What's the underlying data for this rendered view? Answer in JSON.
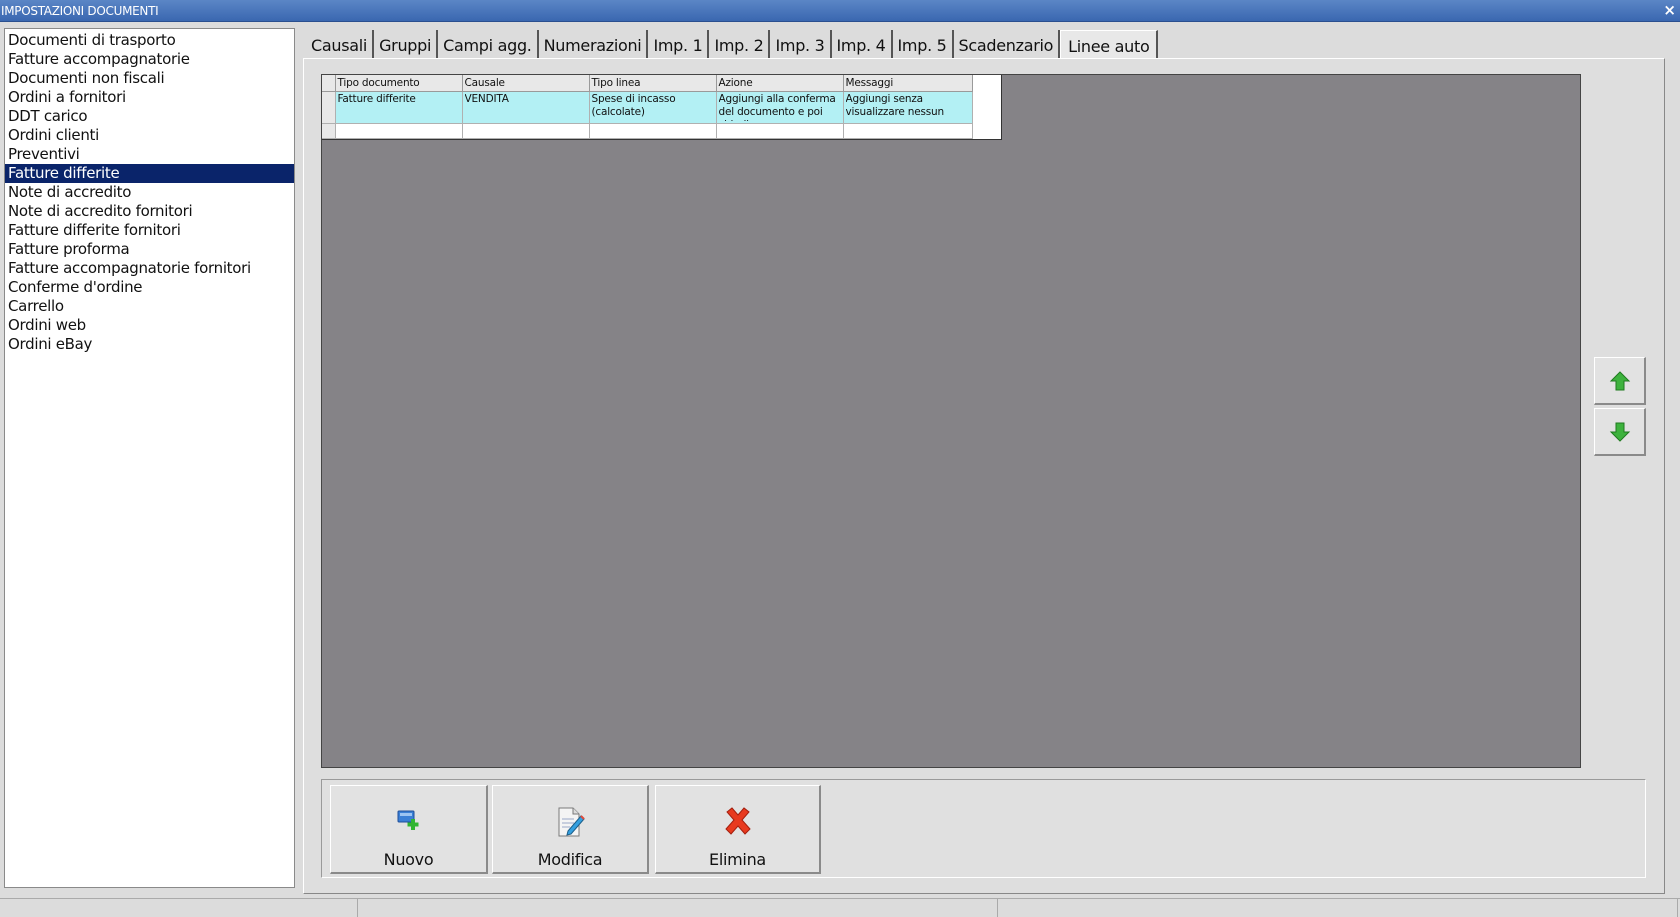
{
  "window": {
    "title": "IMPOSTAZIONI DOCUMENTI",
    "close_label": "×"
  },
  "doc_types": {
    "selected_index": 7,
    "items": [
      "Documenti di trasporto",
      "Fatture accompagnatorie",
      "Documenti non fiscali",
      "Ordini a fornitori",
      "DDT carico",
      "Ordini clienti",
      "Preventivi",
      "Fatture differite",
      "Note di accredito",
      "Note di accredito fornitori",
      "Fatture differite fornitori",
      "Fatture proforma",
      "Fatture accompagnatorie fornitori",
      "Conferme d'ordine",
      "Carrello",
      "Ordini web",
      "Ordini eBay"
    ]
  },
  "tabs": {
    "active_index": 10,
    "items": [
      "Causali",
      "Gruppi",
      "Campi agg.",
      "Numerazioni",
      "Imp. 1",
      "Imp. 2",
      "Imp. 3",
      "Imp. 4",
      "Imp. 5",
      "Scadenzario",
      "Linee auto"
    ]
  },
  "grid": {
    "columns": [
      "Tipo documento",
      "Causale",
      "Tipo linea",
      "Azione",
      "Messaggi"
    ],
    "rows": [
      [
        "Fatture differite",
        "VENDITA",
        "Spese di incasso (calcolate)",
        "Aggiungi alla conferma del documento e poi chiudi ...",
        "Aggiungi senza visualizzare nessun mes..."
      ]
    ]
  },
  "buttons": {
    "new": "Nuovo",
    "edit": "Modifica",
    "delete": "Elimina"
  },
  "colors": {
    "selected_bg": "#0a246a",
    "row_highlight": "#b3f0f4",
    "grid_bg": "#858387",
    "arrow_green": "#3db23d",
    "delete_red": "#e83a1f"
  }
}
